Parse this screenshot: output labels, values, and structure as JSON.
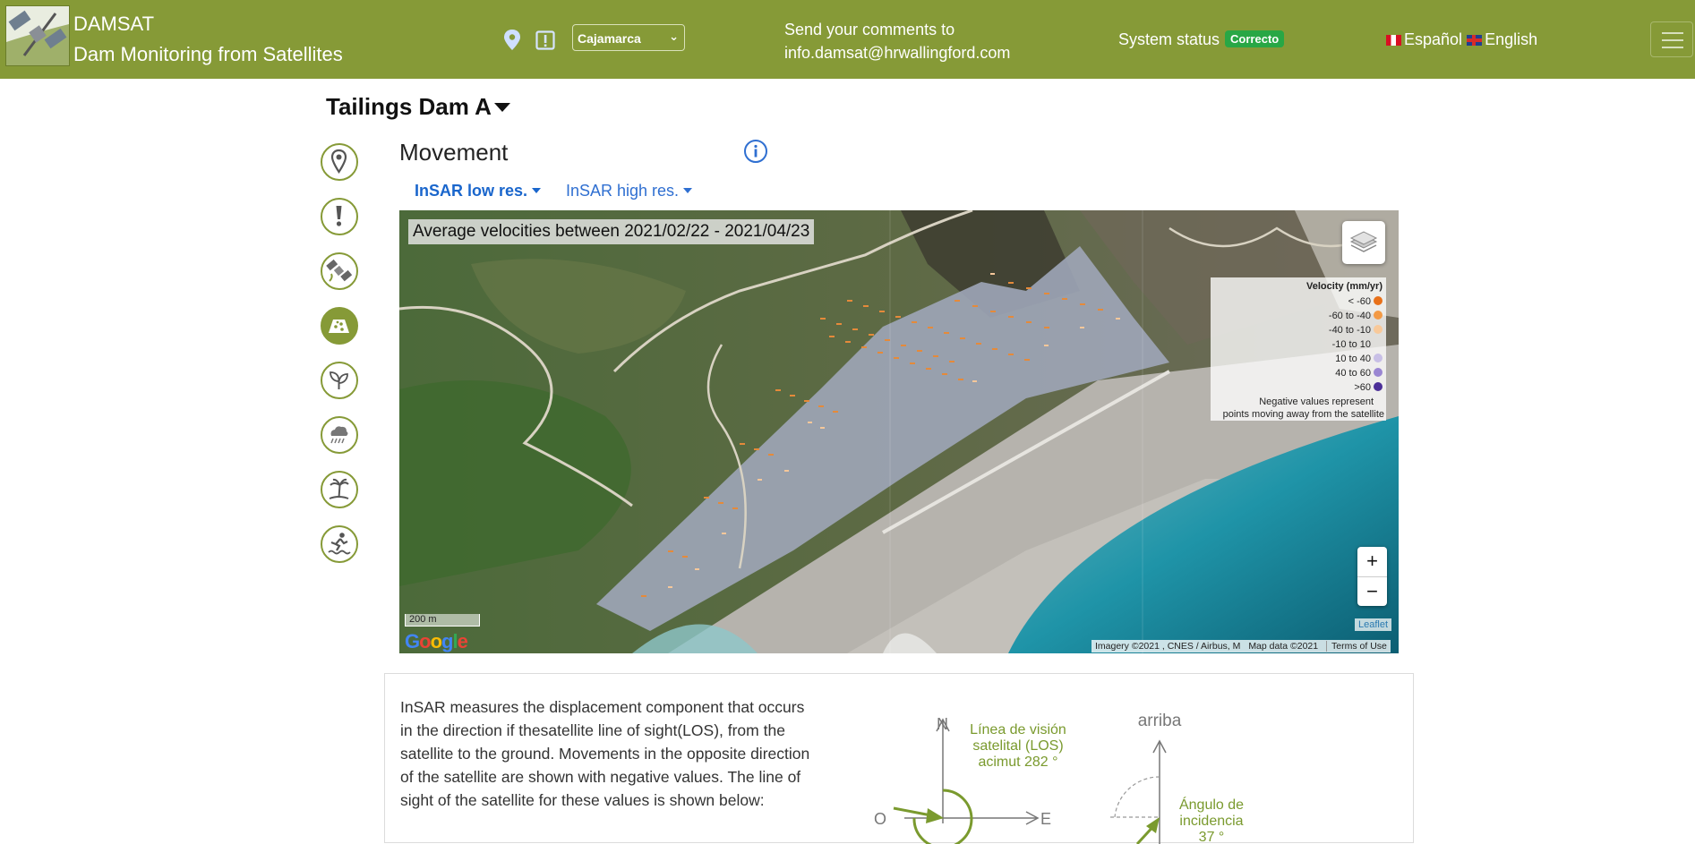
{
  "header": {
    "app_name": "DAMSAT",
    "app_subtitle": "Dam Monitoring from Satellites",
    "location_icon": "map-pin-icon",
    "alert_icon": "alert-square-icon",
    "region_selected": "Cajamarca",
    "comments_line1": "Send your comments to",
    "comments_email": "info.damsat@hrwallingford.com",
    "status_label": "System status",
    "status_value": "Correcto",
    "status_color": "#28a745",
    "lang_es": "Español",
    "lang_en": "English",
    "bar_color": "#869a37"
  },
  "dam": {
    "name": "Tailings Dam A"
  },
  "rail": [
    {
      "name": "location",
      "icon": "map-pin-icon",
      "active": false
    },
    {
      "name": "alerts",
      "icon": "exclamation-icon",
      "active": false
    },
    {
      "name": "satellite",
      "icon": "satellite-icon",
      "active": false
    },
    {
      "name": "movement",
      "icon": "dam-icon",
      "active": true
    },
    {
      "name": "vegetation",
      "icon": "leaf-icon",
      "active": false
    },
    {
      "name": "rainfall",
      "icon": "rain-cloud-icon",
      "active": false
    },
    {
      "name": "climate",
      "icon": "palm-tree-icon",
      "active": false
    },
    {
      "name": "flood",
      "icon": "person-flood-icon",
      "active": false
    }
  ],
  "section": {
    "title": "Movement",
    "info_icon": "info-circle-icon",
    "tabs": [
      {
        "label": "InSAR low res.",
        "active": true
      },
      {
        "label": "InSAR high res.",
        "active": false
      }
    ]
  },
  "map": {
    "caption": "Average velocities between 2021/02/22 - 2021/04/23",
    "legend": {
      "title": "Velocity (mm/yr)",
      "rows": [
        {
          "label": "< -60",
          "color": "#e8711a"
        },
        {
          "label": "-60 to -40",
          "color": "#f39a45"
        },
        {
          "label": "-40 to -10",
          "color": "#f8c99a"
        },
        {
          "label": "-10 to 10",
          "color": ""
        },
        {
          "label": "10 to 40",
          "color": "#c8bfe6"
        },
        {
          "label": "40 to 60",
          "color": "#9a86d2"
        },
        {
          "label": ">60",
          "color": "#4c2f98"
        }
      ],
      "note_line1": "Negative values represent",
      "note_line2": "points moving away from the satellite"
    },
    "zoom_in": "+",
    "zoom_out": "−",
    "scale_label": "200 m",
    "google_logo": "Google",
    "leaflet_label": "Leaflet",
    "attribution": "Imagery ©2021 , CNES / Airbus, M",
    "map_data": "Map data ©2021",
    "terms": "Terms of Use"
  },
  "explanation": {
    "text": "InSAR measures the displacement component that occurs in the direction if thesatellite line of sight(LOS), from the satellite to the ground. Movements in the opposite direction of the satellite are shown with negative values. The line of sight of the satellite for these values is shown below:",
    "diagram": {
      "north": "N",
      "west": "O",
      "east": "E",
      "los_line1": "Línea de visión",
      "los_line2": "satelital (LOS)",
      "los_line3": "acimut 282 °",
      "up": "arriba",
      "inc_line1": "Ángulo de",
      "inc_line2": "incidencia",
      "inc_line3": "37 °",
      "accent": "#7a9a2e"
    }
  }
}
